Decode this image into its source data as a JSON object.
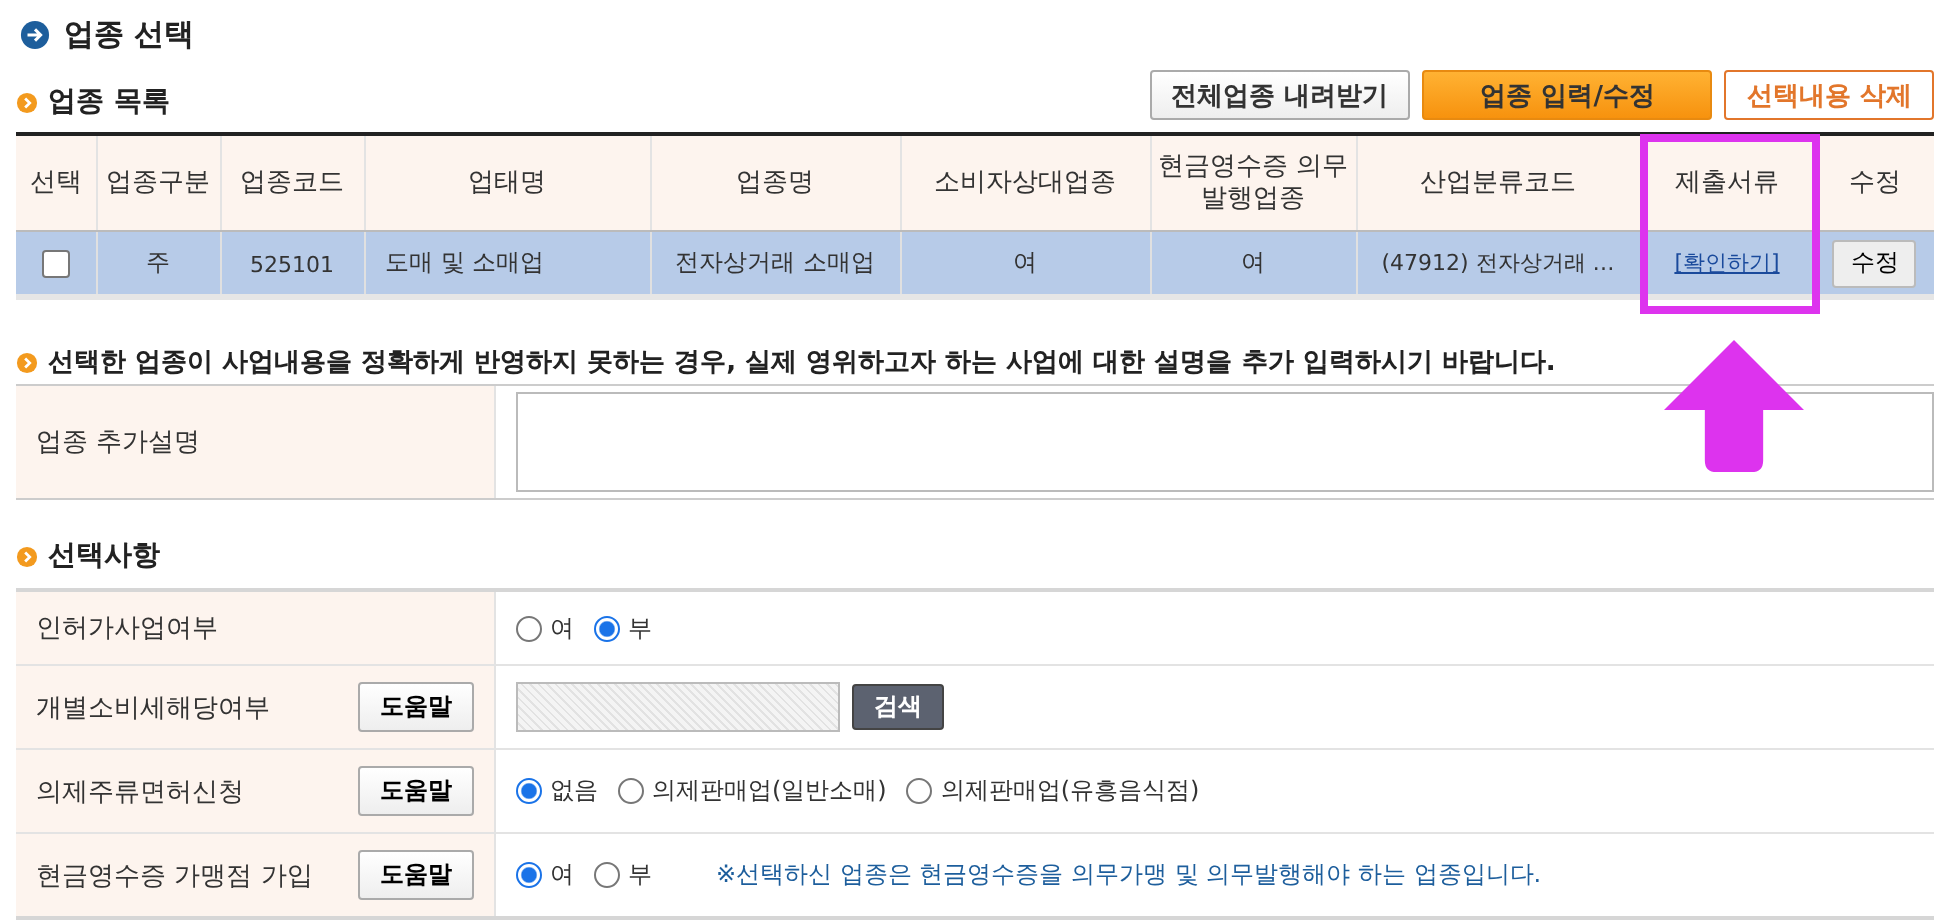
{
  "title": "업종 선택",
  "list_section": {
    "heading": "업종 목록",
    "buttons": [
      {
        "label": "전체업종 내려받기",
        "kind": "default"
      },
      {
        "label": "업종 입력/수정",
        "kind": "primary"
      },
      {
        "label": "선택내용 삭제",
        "kind": "outline"
      }
    ],
    "columns": [
      "선택",
      "업종구분",
      "업종코드",
      "업태명",
      "업종명",
      "소비자상대업종",
      "현금영수증 의무발행업종",
      "산업분류코드",
      "제출서류",
      "수정"
    ],
    "rows": [
      {
        "selected": true,
        "checked": false,
        "division": "주",
        "code": "525101",
        "business_type": "도매 및 소매업",
        "business_item": "전자상거래 소매업",
        "consumer": "여",
        "cash_receipt": "여",
        "industry_code": "(47912) 전자상거래 …",
        "documents_link": "[확인하기]",
        "edit_button": "수정"
      }
    ]
  },
  "note": "선택한 업종이 사업내용을 정확하게 반영하지 못하는 경우, 실제 영위하고자 하는 사업에 대한 설명을 추가 입력하시기 바랍니다.",
  "description": {
    "label": "업종 추가설명"
  },
  "options": {
    "heading": "선택사항",
    "rows": [
      {
        "label": "인허가사업여부",
        "kind": "radio",
        "choices": [
          {
            "label": "여",
            "selected": false
          },
          {
            "label": "부",
            "selected": true
          }
        ]
      },
      {
        "label": "개별소비세해당여부",
        "help_button": "도움말",
        "kind": "search",
        "search_button": "검색"
      },
      {
        "label": "의제주류면허신청",
        "help_button": "도움말",
        "kind": "radio",
        "choices": [
          {
            "label": "없음",
            "selected": true
          },
          {
            "label": "의제판매업(일반소매)",
            "selected": false
          },
          {
            "label": "의제판매업(유흥음식점)",
            "selected": false
          }
        ]
      },
      {
        "label": "현금영수증 가맹점 가입",
        "help_button": "도움말",
        "kind": "radio",
        "choices": [
          {
            "label": "여",
            "selected": true
          },
          {
            "label": "부",
            "selected": false
          }
        ],
        "notice": "※선택하신 업종은 현금영수증을 의무가맹 및 의무발행해야 하는 업종입니다."
      }
    ]
  }
}
